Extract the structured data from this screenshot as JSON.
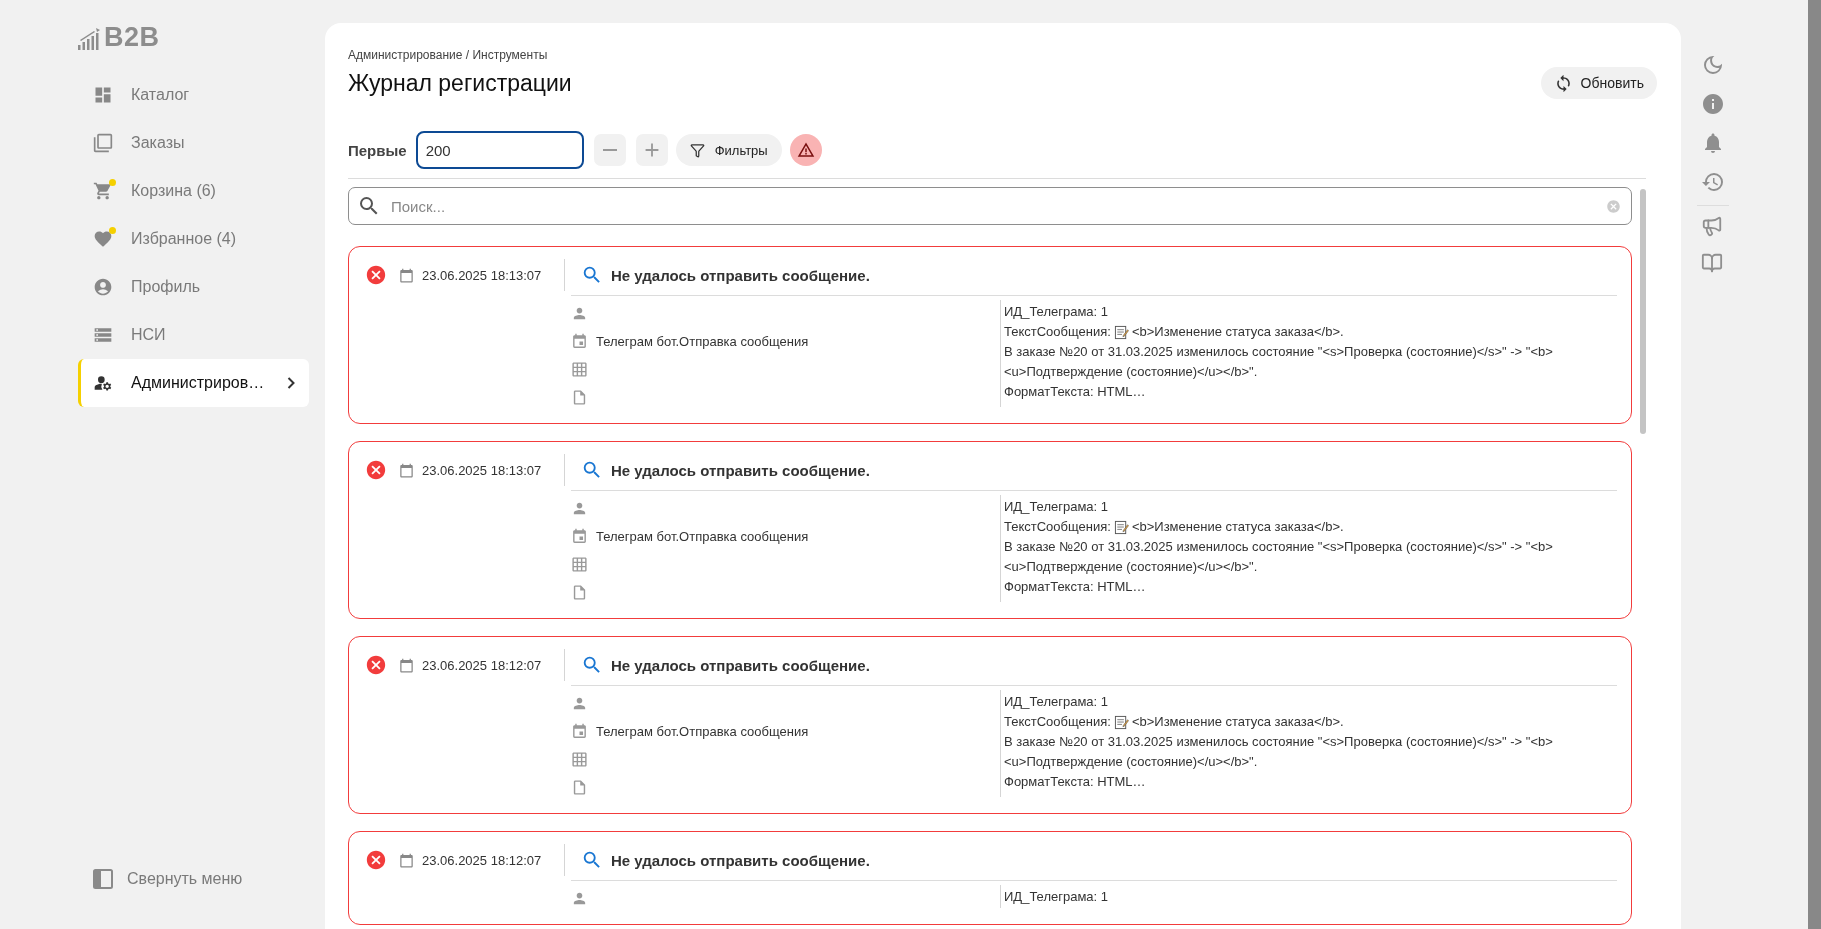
{
  "logo": {
    "text": "B2B"
  },
  "sidebar": {
    "items": [
      {
        "label": "Каталог",
        "selected": false,
        "dot": false,
        "submenu": false
      },
      {
        "label": "Заказы",
        "selected": false,
        "dot": false,
        "submenu": false
      },
      {
        "label": "Корзина (6)",
        "selected": false,
        "dot": true,
        "submenu": false
      },
      {
        "label": "Избранное (4)",
        "selected": false,
        "dot": true,
        "submenu": false
      },
      {
        "label": "Профиль",
        "selected": false,
        "dot": false,
        "submenu": false
      },
      {
        "label": "НСИ",
        "selected": false,
        "dot": false,
        "submenu": false
      },
      {
        "label": "Администриров…",
        "selected": true,
        "dot": false,
        "submenu": true
      }
    ],
    "collapse": "Свернуть меню"
  },
  "header": {
    "breadcrumb": "Администрирование / Инструменты",
    "title": "Журнал регистрации",
    "refresh": "Обновить"
  },
  "toolbar": {
    "label": "Первые",
    "value": "200",
    "filters": "Фильтры"
  },
  "search": {
    "placeholder": "Поиск..."
  },
  "entries": [
    {
      "kind": "error",
      "datetime": "23.06.2025 18:13:07",
      "title": "Не удалось отправить сообщение.",
      "source": "Телеграм бот.Отправка сообщения",
      "details": [
        {
          "kind": "text",
          "text": "ИД_Телеграма: 1"
        },
        {
          "kind": "memo",
          "label": "ТекстСообщения:",
          "text": "<b>Изменение статуса заказа</b>."
        },
        {
          "kind": "text",
          "text": "В заказе №20 от 31.03.2025 изменилось состояние \"<s>Проверка (состояние)</s>\" -> \"<b>"
        },
        {
          "kind": "text",
          "text": "<u>Подтверждение (состояние)</u></b>\"."
        },
        {
          "kind": "text",
          "text": "ФорматТекста: HTML…"
        }
      ]
    },
    {
      "kind": "error",
      "datetime": "23.06.2025 18:13:07",
      "title": "Не удалось отправить сообщение.",
      "source": "Телеграм бот.Отправка сообщения",
      "details": [
        {
          "kind": "text",
          "text": "ИД_Телеграма: 1"
        },
        {
          "kind": "memo",
          "label": "ТекстСообщения:",
          "text": "<b>Изменение статуса заказа</b>."
        },
        {
          "kind": "text",
          "text": "В заказе №20 от 31.03.2025 изменилось состояние \"<s>Проверка (состояние)</s>\" -> \"<b>"
        },
        {
          "kind": "text",
          "text": "<u>Подтверждение (состояние)</u></b>\"."
        },
        {
          "kind": "text",
          "text": "ФорматТекста: HTML…"
        }
      ]
    },
    {
      "kind": "error",
      "datetime": "23.06.2025 18:12:07",
      "title": "Не удалось отправить сообщение.",
      "source": "Телеграм бот.Отправка сообщения",
      "details": [
        {
          "kind": "text",
          "text": "ИД_Телеграма: 1"
        },
        {
          "kind": "memo",
          "label": "ТекстСообщения:",
          "text": "<b>Изменение статуса заказа</b>."
        },
        {
          "kind": "text",
          "text": "В заказе №20 от 31.03.2025 изменилось состояние \"<s>Проверка (состояние)</s>\" -> \"<b>"
        },
        {
          "kind": "text",
          "text": "<u>Подтверждение (состояние)</u></b>\"."
        },
        {
          "kind": "text",
          "text": "ФорматТекста: HTML…"
        }
      ]
    },
    {
      "kind": "error",
      "datetime": "23.06.2025 18:12:07",
      "title": "Не удалось отправить сообщение.",
      "details": [
        {
          "kind": "text",
          "text": "ИД_Телеграма: 1"
        }
      ]
    }
  ]
}
